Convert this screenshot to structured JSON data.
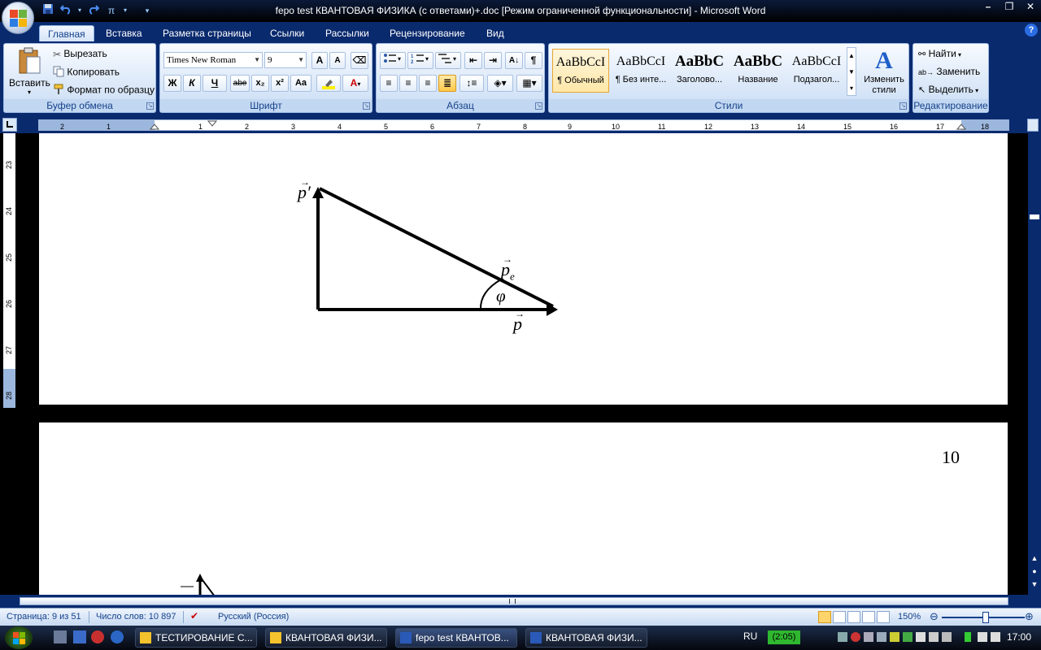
{
  "window": {
    "title": "fepo test КВАНТОВАЯ ФИЗИКА (с ответами)+.doc [Режим ограниченной функциональности] - Microsoft Word",
    "controls": [
      "–",
      "❐",
      "✕"
    ]
  },
  "quick_access": {
    "save_icon": "save-icon",
    "undo_icon": "undo-icon",
    "redo_icon": "redo-icon",
    "formula_glyph": "π"
  },
  "tabs": [
    "Главная",
    "Вставка",
    "Разметка страницы",
    "Ссылки",
    "Рассылки",
    "Рецензирование",
    "Вид"
  ],
  "ribbon": {
    "clipboard": {
      "label": "Буфер обмена",
      "paste": "Вставить",
      "cut": "Вырезать",
      "copy": "Копировать",
      "format_painter": "Формат по образцу"
    },
    "font": {
      "label": "Шрифт",
      "font_name": "Times New Roman",
      "font_size": "9",
      "grow": "A",
      "shrink": "A",
      "bold": "Ж",
      "italic": "К",
      "underline": "Ч",
      "strike": "abe",
      "subscript": "x₂",
      "superscript": "x²",
      "case": "Aa",
      "font_color_letter": "A"
    },
    "paragraph": {
      "label": "Абзац",
      "pilcrow": "¶"
    },
    "styles": {
      "label": "Стили",
      "items": [
        {
          "sample": "AaBbCcI",
          "name": "¶ Обычный"
        },
        {
          "sample": "AaBbCcI",
          "name": "¶ Без инте..."
        },
        {
          "sample": "AaBbC",
          "name": "Заголово..."
        },
        {
          "sample": "AaBbC",
          "name": "Название"
        },
        {
          "sample": "AaBbCcI",
          "name": "Подзагол..."
        }
      ],
      "change_styles": "Изменить стили"
    },
    "editing": {
      "label": "Редактирование",
      "find": "Найти",
      "replace": "Заменить",
      "select": "Выделить"
    }
  },
  "ruler": {
    "h_labels": [
      "2",
      "1",
      "1",
      "1",
      "2",
      "3",
      "4",
      "5",
      "6",
      "7",
      "8",
      "9",
      "10",
      "11",
      "12",
      "13",
      "14",
      "15",
      "16",
      "17",
      "18"
    ],
    "v_labels": [
      "23",
      "24",
      "25",
      "26",
      "27",
      "28"
    ]
  },
  "document": {
    "diagram": {
      "label_p_prime": "p′",
      "label_pe": "p",
      "label_pe_sub": "e",
      "label_phi": "φ",
      "label_p": "p"
    },
    "page_number": "10"
  },
  "status": {
    "page": "Страница: 9 из 51",
    "words": "Число слов: 10 897",
    "language": "Русский (Россия)",
    "zoom": "150%"
  },
  "taskbar": {
    "windows": [
      "ТЕСТИРОВАНИЕ С...",
      "КВАНТОВАЯ ФИЗИ...",
      "fepo test КВАНТОВ...",
      "КВАНТОВАЯ ФИЗИ..."
    ],
    "lang": "RU",
    "battery_badge": "(2:05)",
    "clock": "17:00"
  }
}
